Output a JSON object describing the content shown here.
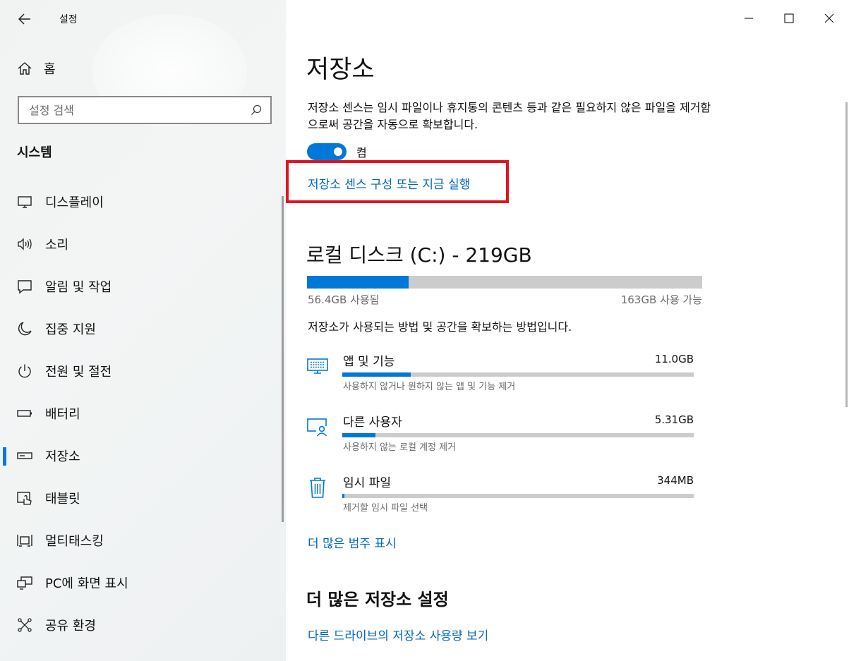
{
  "window": {
    "app_title": "설정",
    "controls": [
      "minimize",
      "maximize",
      "close"
    ]
  },
  "sidebar": {
    "home_label": "홈",
    "search": {
      "placeholder": "설정 검색",
      "value": ""
    },
    "section_heading": "시스템",
    "items": [
      {
        "label": "디스플레이",
        "icon": "display-icon",
        "selected": false
      },
      {
        "label": "소리",
        "icon": "speaker-icon",
        "selected": false
      },
      {
        "label": "알림 및 작업",
        "icon": "notification-icon",
        "selected": false
      },
      {
        "label": "집중 지원",
        "icon": "moon-icon",
        "selected": false
      },
      {
        "label": "전원 및 절전",
        "icon": "power-icon",
        "selected": false
      },
      {
        "label": "배터리",
        "icon": "battery-icon",
        "selected": false
      },
      {
        "label": "저장소",
        "icon": "storage-icon",
        "selected": true
      },
      {
        "label": "태블릿",
        "icon": "tablet-icon",
        "selected": false
      },
      {
        "label": "멀티태스킹",
        "icon": "multitasking-icon",
        "selected": false
      },
      {
        "label": "PC에 화면 표시",
        "icon": "projecting-icon",
        "selected": false
      },
      {
        "label": "공유 환경",
        "icon": "shared-experiences-icon",
        "selected": false
      }
    ]
  },
  "main": {
    "title": "저장소",
    "description": "저장소 센스는 임시 파일이나 휴지통의 콘텐츠 등과 같은 필요하지 않은 파일을 제거함으로써 공간을 자동으로 확보합니다.",
    "toggle": {
      "state": "on",
      "label": "켬"
    },
    "sense_link": "저장소 센스 구성 또는 지금 실행",
    "disk": {
      "title": "로컬 디스크 (C:) - 219GB",
      "used_label": "56.4GB 사용됨",
      "free_label": "163GB 사용 가능",
      "used_fraction": 0.257
    },
    "usage_description": "저장소가 사용되는 방법 및 공간을 확보하는 방법입니다.",
    "categories": [
      {
        "name": "앱 및 기능",
        "size": "11.0GB",
        "subtitle": "사용하지 않거나 원하지 않는 앱 및 기능 제거",
        "fraction": 0.195,
        "icon": "apps-icon"
      },
      {
        "name": "다른 사용자",
        "size": "5.31GB",
        "subtitle": "사용하지 않는 로컬 계정 제거",
        "fraction": 0.094,
        "icon": "other-users-icon"
      },
      {
        "name": "임시 파일",
        "size": "344MB",
        "subtitle": "제거할 임시 파일 선택",
        "fraction": 0.006,
        "icon": "trash-icon"
      }
    ],
    "more_categories_link": "더 많은 범주 표시",
    "more_settings_heading": "더 많은 저장소 설정",
    "other_drives_link": "다른 드라이브의 저장소 사용량 보기"
  },
  "colors": {
    "accent": "#0078d7",
    "link": "#0067c0",
    "highlight_border": "#e3141f",
    "bar_track": "#cccccc"
  }
}
